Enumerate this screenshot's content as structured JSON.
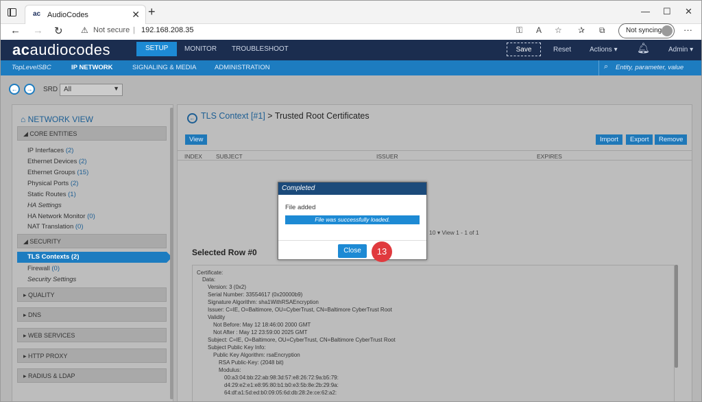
{
  "browser": {
    "tab_title": "AudioCodes",
    "tab_favicon": "ac",
    "security_label": "Not secure",
    "url": "192.168.208.35",
    "sync_label": "Not syncing"
  },
  "app": {
    "logo_mark": "ac",
    "logo_text": "audiocodes",
    "main_tabs": [
      "SETUP",
      "MONITOR",
      "TROUBLESHOOT"
    ],
    "save_label": "Save",
    "reset_label": "Reset",
    "actions_label": "Actions ▾",
    "admin_label": "Admin ▾",
    "sub_tabs": [
      "TopLevelSBC",
      "IP NETWORK",
      "SIGNALING & MEDIA",
      "ADMINISTRATION"
    ],
    "search_placeholder": "Entity, parameter, value"
  },
  "srd": {
    "label": "SRD",
    "value": "All"
  },
  "sidebar": {
    "title": "NETWORK VIEW",
    "core_entities": "CORE ENTITIES",
    "items": [
      {
        "label": "IP Interfaces",
        "count": "(2)"
      },
      {
        "label": "Ethernet Devices",
        "count": "(2)"
      },
      {
        "label": "Ethernet Groups",
        "count": "(15)"
      },
      {
        "label": "Physical Ports",
        "count": "(2)"
      },
      {
        "label": "Static Routes",
        "count": "(1)"
      },
      {
        "label": "HA Settings",
        "count": ""
      },
      {
        "label": "HA Network Monitor",
        "count": "(0)"
      },
      {
        "label": "NAT Translation",
        "count": "(0)"
      }
    ],
    "security": "SECURITY",
    "security_items": [
      {
        "label": "TLS Contexts",
        "count": "(2)"
      },
      {
        "label": "Firewall",
        "count": "(0)"
      },
      {
        "label": "Security Settings",
        "count": ""
      }
    ],
    "sections": [
      "QUALITY",
      "DNS",
      "WEB SERVICES",
      "HTTP PROXY",
      "RADIUS & LDAP"
    ]
  },
  "main": {
    "title_link": "TLS Context [#1]",
    "title_rest": "> Trusted Root Certificates",
    "view_button": "View",
    "import_button": "Import",
    "export_button": "Export",
    "remove_button": "Remove",
    "columns": [
      "INDEX",
      "SUBJECT",
      "ISSUER",
      "EXPIRES"
    ],
    "pagination": "10 ▾   View 1 - 1 of 1",
    "selected_row": "Selected Row #0",
    "cert_lines": [
      "Certificate:",
      "Data:",
      "Version: 3 (0x2)",
      "Serial Number: 33554617 (0x20000b9)",
      "Signature Algorithm: sha1WithRSAEncryption",
      "Issuer: C=IE, O=Baltimore, OU=CyberTrust, CN=Baltimore CyberTrust Root",
      "Validity",
      "Not Before: May 12 18:46:00 2000 GMT",
      "Not After : May 12 23:59:00 2025 GMT",
      "Subject: C=IE, O=Baltimore, OU=CyberTrust, CN=Baltimore CyberTrust Root",
      "Subject Public Key Info:",
      "Public Key Algorithm: rsaEncryption",
      "RSA Public-Key: (2048 bit)",
      "Modulus:",
      "00:a3:04:bb:22:ab:98:3d:57:e8:26:72:9a:b5:79:",
      "d4:29:e2:e1:e8:95:80:b1:b0:e3:5b:8e:2b:29:9a:",
      "64:df:a1:5d:ed:b0:09:05:6d:db:28:2e:ce:62:a2:"
    ]
  },
  "modal": {
    "title": "Completed",
    "message": "File added",
    "status": "File was successfully loaded.",
    "close_button": "Close"
  },
  "step_marker": "13"
}
